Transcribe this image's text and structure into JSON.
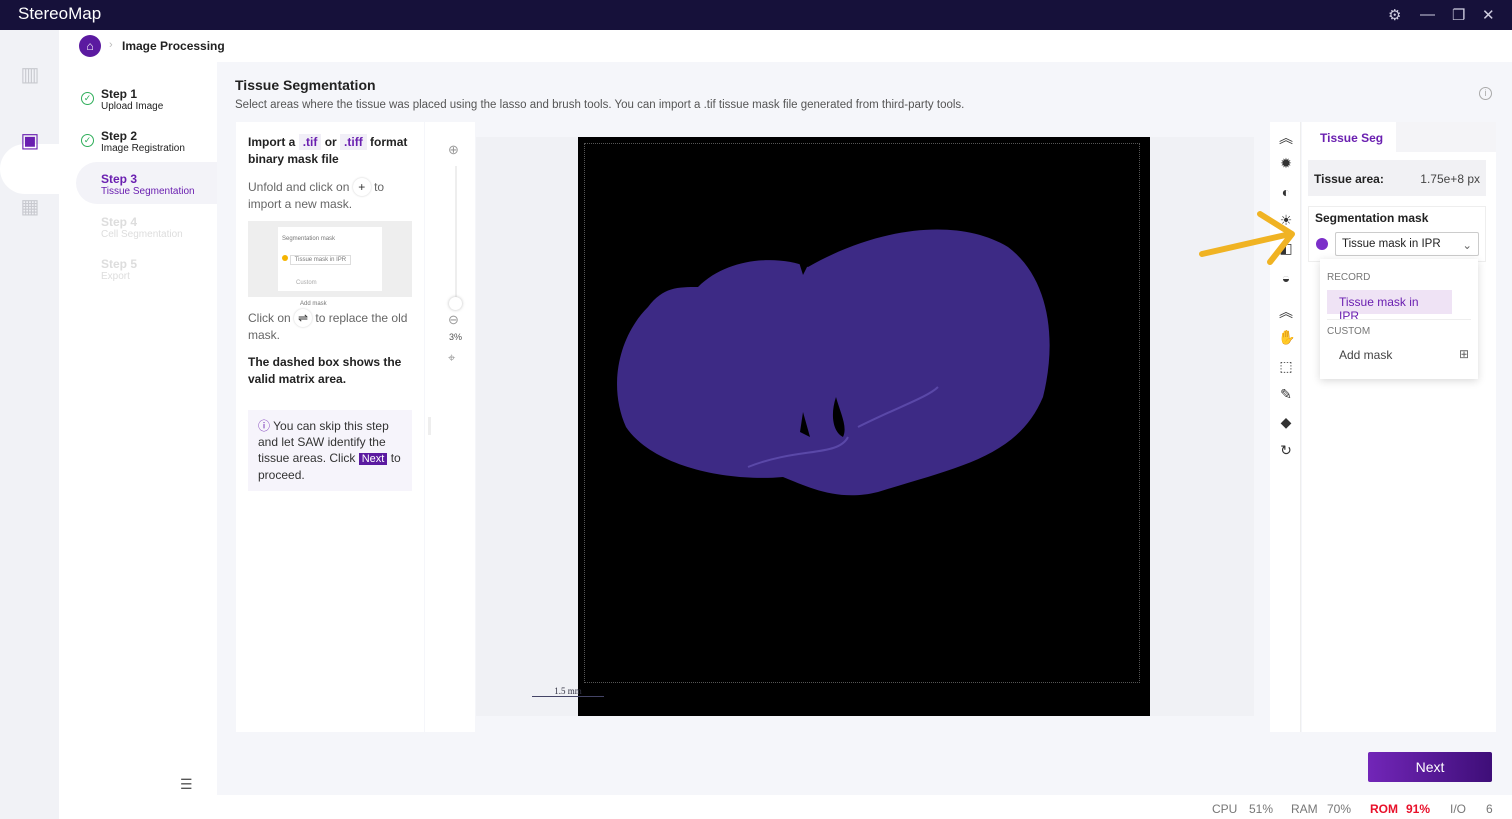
{
  "app": {
    "title": "StereoMap"
  },
  "breadcrumb": {
    "current": "Image Processing"
  },
  "steps": [
    {
      "title": "Step 1",
      "sub": "Upload Image"
    },
    {
      "title": "Step 2",
      "sub": "Image Registration"
    },
    {
      "title": "Step 3",
      "sub": "Tissue Segmentation"
    },
    {
      "title": "Step 4",
      "sub": "Cell Segmentation"
    },
    {
      "title": "Step 5",
      "sub": "Export"
    }
  ],
  "main": {
    "title": "Tissue Segmentation",
    "subtitle": "Select areas where the tissue was placed using the lasso and brush tools. You can import a .tif tissue mask file generated from third-party tools."
  },
  "instructions": {
    "import_a": "Import a",
    "tif": ".tif",
    "or": "or",
    "tiff": ".tiff",
    "format": "format",
    "binary": "binary mask file",
    "unfold": "Unfold and click on",
    "plus": "+",
    "to": "to",
    "import_new": "import a new mask.",
    "preview_title": "Segmentation mask",
    "preview_select": "Tissue mask in IPR",
    "preview_custom": "Custom",
    "preview_add": "Add mask",
    "click_on": "Click on",
    "swap": "⇌",
    "replace": "to replace the old mask.",
    "dashed": "The dashed box shows the valid matrix area.",
    "tip_pre": "You can skip this step and let SAW identify the tissue areas. Click",
    "tip_next": "Next",
    "tip_post": "to proceed."
  },
  "zoom": {
    "level": "3%"
  },
  "scalebar": {
    "label": "1.5 mm"
  },
  "panel": {
    "tab": "Tissue Seg",
    "area_label": "Tissue area:",
    "area_value": "1.75e+8 px",
    "seg_label": "Segmentation mask",
    "selected": "Tissue mask in IPR",
    "record_header": "RECORD",
    "record_item": "Tissue mask in IPR",
    "custom_header": "CUSTOM",
    "add_mask": "Add mask",
    "mask_color": "#7b2fc9"
  },
  "footer": {
    "next": "Next"
  },
  "status": {
    "cpu_label": "CPU",
    "cpu": "51%",
    "ram_label": "RAM",
    "ram": "70%",
    "rom_label": "ROM",
    "rom": "91%",
    "io_label": "I/O",
    "io": "6"
  }
}
